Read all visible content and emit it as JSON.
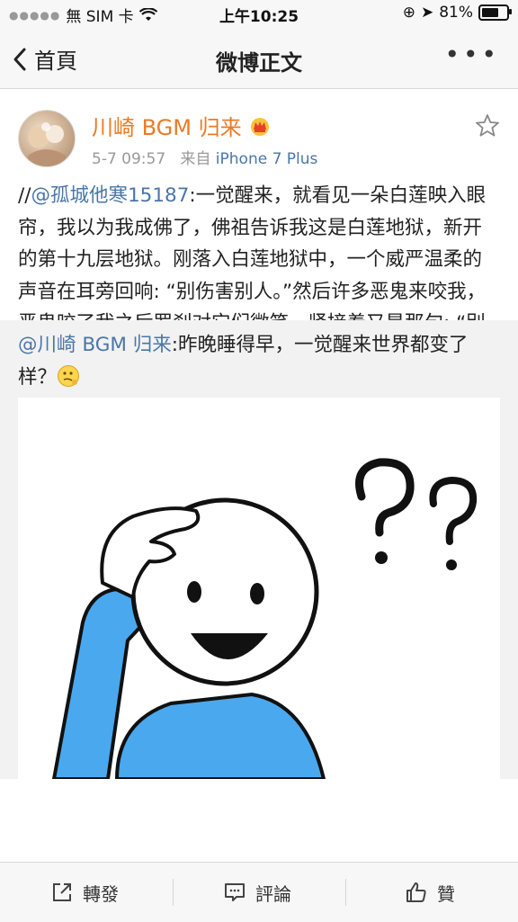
{
  "status_bar": {
    "carrier": "無 SIM 卡",
    "time": "上午10:25",
    "battery": "81%",
    "battery_level": 0.81
  },
  "nav": {
    "back_label": "首頁",
    "title": "微博正文",
    "more_icon": "more-icon"
  },
  "post": {
    "author": "川崎 BGM 归来",
    "time": "5-7 09:57",
    "source_prefix": "来自",
    "device": "iPhone 7 Plus",
    "text_prefix": "//",
    "mention": "@孤城他寒15187",
    "text": ":一觉醒来，就看见一朵白莲映入眼帘，我以为我成佛了，佛祖告诉我这是白莲地狱，新开的第十九层地狱。刚落入白莲地狱中，一个威严温柔的声音在耳旁回响: “别伤害别人。”然后许多恶鬼来咬我，恶鬼咬了我之后罗刹对它们微笑，紧接着又是那句: “别伤害别人。”恶鬼们兴奋地又来咬我了..."
  },
  "repost": {
    "mention": "@川崎 BGM 归来",
    "text": ":昨晚睡得早，一觉醒来世界都变了样？"
  },
  "toolbar": {
    "repost_label": "轉發",
    "comment_label": "評論",
    "like_label": "贊"
  },
  "colors": {
    "accent_orange": "#ea7b23",
    "link_blue": "#4a76a8",
    "figure_blue": "#4aa8ee"
  }
}
